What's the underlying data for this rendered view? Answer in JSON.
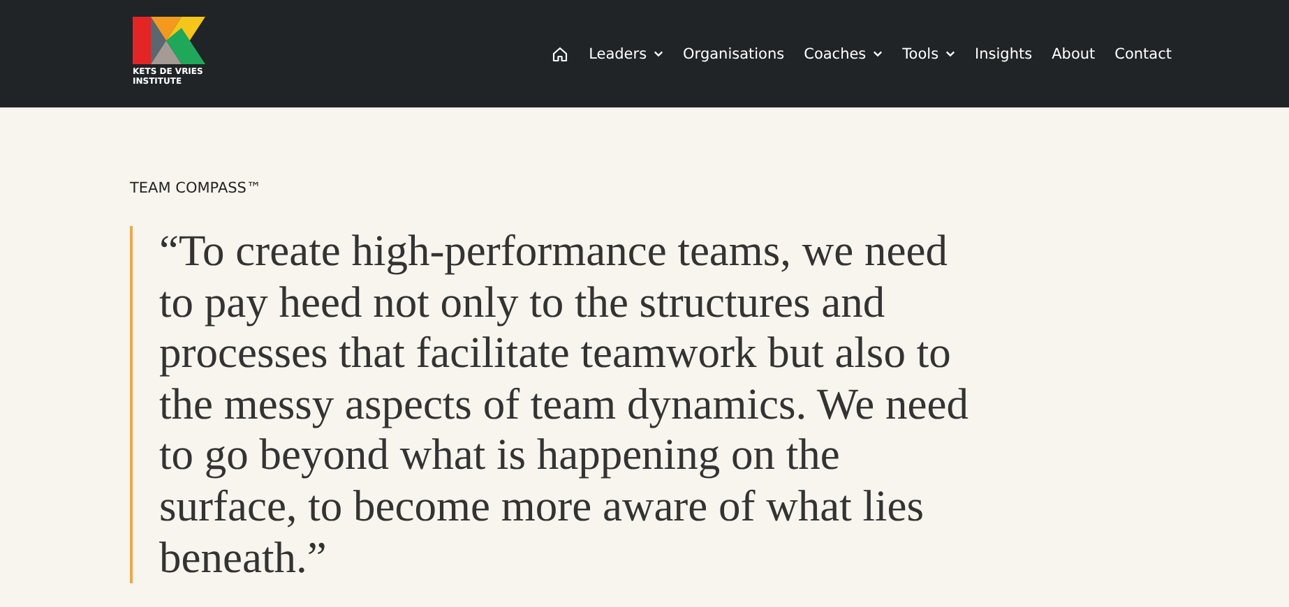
{
  "header": {
    "logo_text": [
      "KETS DE VRIES",
      "INSTITUTE"
    ],
    "nav": [
      {
        "kind": "home"
      },
      {
        "kind": "dropdown",
        "label": "Leaders"
      },
      {
        "kind": "link",
        "label": "Organisations"
      },
      {
        "kind": "dropdown",
        "label": "Coaches"
      },
      {
        "kind": "dropdown",
        "label": "Tools"
      },
      {
        "kind": "link",
        "label": "Insights"
      },
      {
        "kind": "link",
        "label": "About"
      },
      {
        "kind": "link",
        "label": "Contact"
      }
    ]
  },
  "section": {
    "eyebrow": "TEAM COMPASS™",
    "quote": "“To create high-performance teams, we need to pay heed not only to the structures and processes that facilitate teamwork but also to the messy aspects of team dynamics. We need to go beyond what is happening on the surface, to become more aware of what lies beneath.”"
  }
}
